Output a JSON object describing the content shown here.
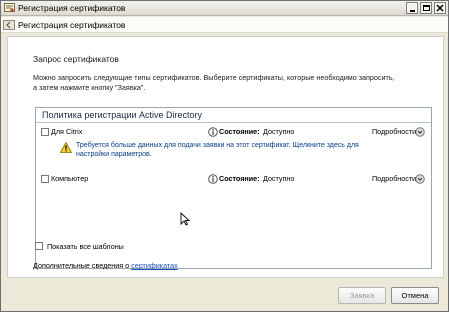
{
  "window": {
    "title": "Регистрация сертификатов",
    "controls": {
      "minimize": "minimize-icon",
      "maximize": "maximize-icon",
      "close": "close-icon"
    }
  },
  "wizard": {
    "header_title": "Регистрация сертификатов"
  },
  "content": {
    "section_title": "Запрос сертификатов",
    "intro_line1": "Можно запросить следующие типы сертификатов. Выберите сертификаты, которые необходимо запросить,",
    "intro_line2": "а затем нажмите кнопку \"Заявка\".",
    "policy": {
      "title": "Политика регистрации Active Directory",
      "items": [
        {
          "name": "Для Citrix",
          "checked": false,
          "status_label": "Состояние:",
          "status_value": "Доступно",
          "details": "Подробности",
          "warning_line1": "Требуется больше данных для подачи заявки на этот сертификат. Щелкните здесь для",
          "warning_line2": "настройки параметров."
        },
        {
          "name": "Компьютер",
          "checked": false,
          "status_label": "Состояние:",
          "status_value": "Доступно",
          "details": "Подробности"
        }
      ]
    },
    "show_all_label": "Показать все шаблоны",
    "more_info_prefix": "Дополнительные сведения о ",
    "more_info_link": "сертификатах"
  },
  "footer": {
    "enroll_label": "Заявка",
    "cancel_label": "Отмена"
  },
  "colors": {
    "warning_text": "#0a3d8c",
    "link": "#1f4fbf",
    "window_bg": "#ece9d8"
  }
}
